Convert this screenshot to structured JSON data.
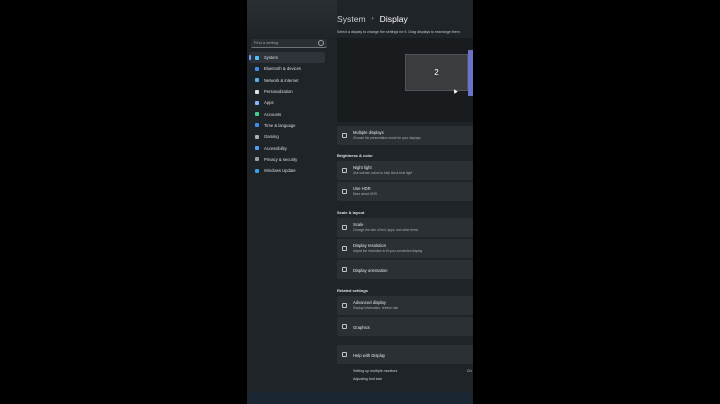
{
  "search": {
    "placeholder": "Find a setting"
  },
  "nav": [
    {
      "label": "System",
      "icon": "monitor-icon",
      "color": "#4cc2ff"
    },
    {
      "label": "Bluetooth & devices",
      "icon": "bluetooth-icon",
      "color": "#3a8eea"
    },
    {
      "label": "Network & internet",
      "icon": "wifi-icon",
      "color": "#5ab1e8"
    },
    {
      "label": "Personalization",
      "icon": "brush-icon",
      "color": "#e0e0e0"
    },
    {
      "label": "Apps",
      "icon": "apps-icon",
      "color": "#8ab4f8"
    },
    {
      "label": "Accounts",
      "icon": "person-icon",
      "color": "#3ecf8e"
    },
    {
      "label": "Time & language",
      "icon": "globe-icon",
      "color": "#3a8eea"
    },
    {
      "label": "Gaming",
      "icon": "gamepad-icon",
      "color": "#b0b0b0"
    },
    {
      "label": "Accessibility",
      "icon": "accessibility-icon",
      "color": "#4ca0ff"
    },
    {
      "label": "Privacy & security",
      "icon": "shield-icon",
      "color": "#9aa0a6"
    },
    {
      "label": "Windows Update",
      "icon": "update-icon",
      "color": "#3ba0e8"
    }
  ],
  "breadcrumb": {
    "parent": "System",
    "separator": "›",
    "current": "Display"
  },
  "hint": "Select a display to change the settings for it. Drag displays to rearrange them.",
  "preview": {
    "monitor_label": "2"
  },
  "multiple_displays": {
    "title": "Multiple displays",
    "subtitle": "Choose the presentation mode for your displays"
  },
  "brightness": {
    "header": "Brightness & color",
    "night_light": {
      "title": "Night light",
      "subtitle": "Use warmer colors to help block blue light"
    },
    "hdr": {
      "title": "Use HDR",
      "subtitle": "More about HDR"
    }
  },
  "scale_layout": {
    "header": "Scale & layout",
    "scale": {
      "title": "Scale",
      "subtitle": "Change the size of text, apps, and other items"
    },
    "resolution": {
      "title": "Display resolution",
      "subtitle": "Adjust the resolution to fit your connected display"
    },
    "orientation": {
      "title": "Display orientation"
    }
  },
  "related": {
    "header": "Related settings",
    "advanced": {
      "title": "Advanced display",
      "subtitle": "Display information, refresh rate"
    },
    "graphics": {
      "title": "Graphics"
    }
  },
  "help": {
    "title": "Help with Display",
    "links": [
      "Setting up multiple monitors",
      "Adjusting font size"
    ],
    "trailing": "Ch"
  }
}
